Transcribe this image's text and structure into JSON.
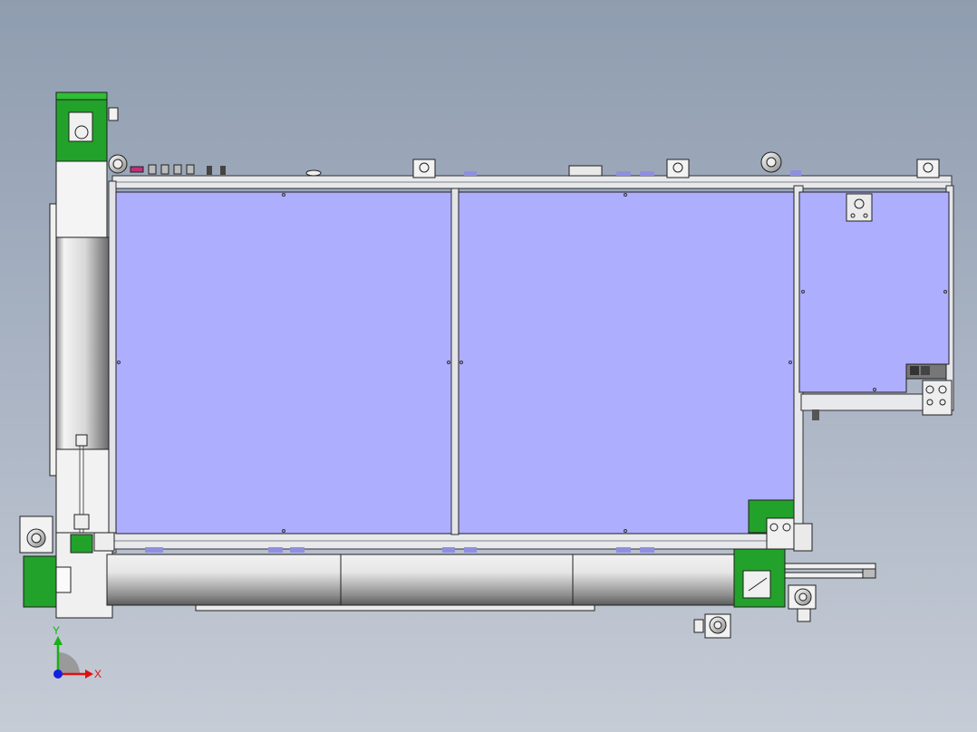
{
  "viewport": {
    "background_top": "#8f9db0",
    "background_bottom": "#c6ccd6"
  },
  "model": {
    "panel_color": "#aeaefe",
    "accent_color": "#22a22a",
    "frame_color": "#e6e8ec",
    "outline_color": "#202020"
  },
  "triad": {
    "x_label": "X",
    "y_label": "Y",
    "x_color": "#e01010",
    "y_color": "#18b018",
    "z_color": "#1020e0"
  }
}
